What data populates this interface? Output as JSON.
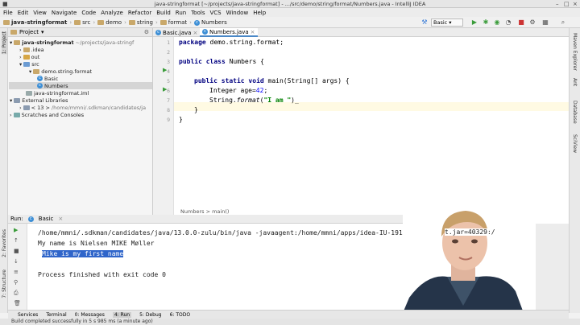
{
  "window": {
    "title": "java-stringformat [~/projects/java-stringformat] - .../src/demo/string/format/Numbers.java - IntelliJ IDEA"
  },
  "menu": [
    "File",
    "Edit",
    "View",
    "Navigate",
    "Code",
    "Analyze",
    "Refactor",
    "Build",
    "Run",
    "Tools",
    "VCS",
    "Window",
    "Help"
  ],
  "breadcrumbs": [
    "java-stringformat",
    "src",
    "demo",
    "string",
    "format",
    "Numbers"
  ],
  "run_config": "Basic",
  "project": {
    "header": "Project",
    "tree": [
      {
        "label": "java-stringformat",
        "extra": "~/projects/java-stringf"
      },
      {
        "label": ".idea",
        "extra": ""
      },
      {
        "label": "out",
        "extra": ""
      },
      {
        "label": "src",
        "extra": ""
      },
      {
        "label": "demo.string.format",
        "extra": ""
      },
      {
        "label": "Basic",
        "extra": ""
      },
      {
        "label": "Numbers",
        "extra": ""
      },
      {
        "label": "java-stringformat.iml",
        "extra": ""
      },
      {
        "label": "External Libraries",
        "extra": ""
      },
      {
        "label": "< 13 >",
        "extra": "/home/mmni/.sdkman/candidates/ja"
      },
      {
        "label": "Scratches and Consoles",
        "extra": ""
      }
    ]
  },
  "editor": {
    "tabs": [
      "Basic.java",
      "Numbers.java"
    ],
    "line_numbers": [
      "1",
      "2",
      "3",
      "4",
      "5",
      "6",
      "7",
      "8",
      "9"
    ],
    "code": {
      "l1_kw": "package",
      "l1_rest": " demo.string.format;",
      "l3_kw": "public class",
      "l3_rest": " Numbers {",
      "l5_kw": "public static void",
      "l5_rest": " main(String[] args) {",
      "l6_a": "Integer age=",
      "l6_num": "42",
      "l6_b": ";",
      "l7_a": "String.",
      "l7_fn": "format",
      "l7_b": "(",
      "l7_str": "\"I am \"",
      "l7_c": ")",
      "l8": "}",
      "l9": "}"
    },
    "breadcrumb": "Numbers  >  main()"
  },
  "run": {
    "header": "Run:",
    "tab": "Basic",
    "lines": [
      "/home/mmni/.sdkman/candidates/java/13.0.0-zulu/bin/java -javaagent:/home/mmni/apps/idea-IU-191.7141.",
      "My name is Nielsen MIKE Møller",
      "Mike is my first name",
      "",
      "Process finished with exit code 0"
    ],
    "line1_tail": "t.jar=40329:/"
  },
  "side_tabs": {
    "left": [
      "1: Project",
      "2: Favorites",
      "7: Structure"
    ],
    "right": [
      "Maven Explorer",
      "Ant",
      "Database",
      "SciView"
    ]
  },
  "bottom_tabs": [
    "Services",
    "Terminal",
    "0: Messages",
    "4: Run",
    "5: Debug",
    "6: TODO"
  ],
  "status": "Build completed successfully in 5 s 985 ms (a minute ago)"
}
